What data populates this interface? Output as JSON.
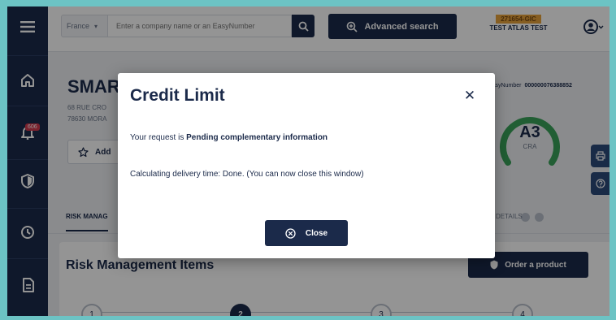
{
  "header": {
    "country": "France",
    "search_placeholder": "Enter a company name or an EasyNumber",
    "advanced_search": "Advanced search",
    "account_code": "271654-GIC",
    "account_name": "TEST ATLAS TEST"
  },
  "sidebar": {
    "items": [
      {
        "icon": "menu-icon"
      },
      {
        "icon": "home-icon"
      },
      {
        "icon": "bell-icon",
        "badge": "606"
      },
      {
        "icon": "shield-icon"
      },
      {
        "icon": "clock-icon"
      },
      {
        "icon": "document-icon"
      }
    ]
  },
  "company": {
    "name": "SMAR",
    "address_line1": "68 RUE CRO",
    "address_line2": "78630 MORA",
    "add_label": "Add",
    "easy_number_label": "EasyNumber",
    "easy_number_value": "000000076388852",
    "grade": "A3",
    "grade_label": "CRA"
  },
  "tabs": {
    "risk": "RISK MANAG",
    "details": "DETAILS"
  },
  "section": {
    "title": "Risk Management Items",
    "order_button": "Order a product",
    "steps": [
      "1",
      "2",
      "3",
      "4"
    ],
    "active_step": 2
  },
  "modal": {
    "title": "Credit Limit",
    "request_prefix": "Your request is ",
    "request_status": "Pending complementary information",
    "delivery_text": "Calculating delivery time: Done. (You can now close this window)",
    "close_button": "Close"
  },
  "colors": {
    "navy": "#1b2a4a",
    "accent_orange": "#e7a23c",
    "gauge_green": "#3aa35a",
    "frame_teal": "#6cc3c4"
  }
}
